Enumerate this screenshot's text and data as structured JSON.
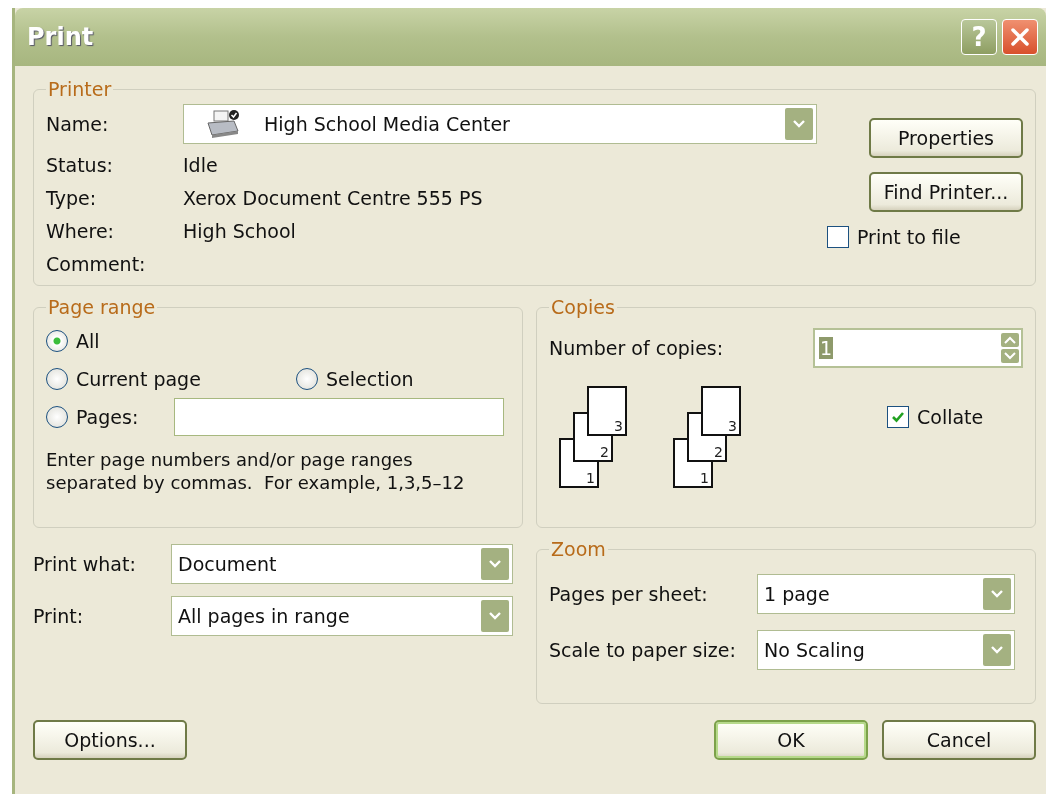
{
  "window": {
    "title": "Print",
    "help_label": "?"
  },
  "printer": {
    "title": "Printer",
    "name_label": "Name:",
    "name": "High School Media Center",
    "info": [
      {
        "label": "Status:",
        "value": "Idle"
      },
      {
        "label": "Type:",
        "value": "Xerox Document Centre 555 PS"
      },
      {
        "label": "Where:",
        "value": "High School"
      },
      {
        "label": "Comment:"
      }
    ],
    "properties_button": "Properties",
    "find_button": "Find Printer...",
    "print_to_file": {
      "label": "Print to file",
      "checked": false
    }
  },
  "page_range": {
    "title": "Page range",
    "options": [
      {
        "label": "All",
        "selected": true
      },
      {
        "label": "Current page",
        "selected": false
      },
      {
        "label": "Selection",
        "selected": false
      },
      {
        "label": "Pages:",
        "selected": false
      }
    ],
    "hint": "Enter page numbers and/or page ranges separated by commas.  For example, 1,3,5–12"
  },
  "copies": {
    "title": "Copies",
    "label": "Number of copies:",
    "value": "1",
    "stacks": [
      {
        "pages": [
          "1",
          "2",
          "3"
        ]
      },
      {
        "pages": [
          "1",
          "2",
          "3"
        ]
      }
    ],
    "collate": {
      "label": "Collate",
      "checked": true
    }
  },
  "print_what": {
    "label": "Print what:",
    "value": "Document"
  },
  "print": {
    "label": "Print:",
    "value": "All pages in range"
  },
  "zoom": {
    "title": "Zoom",
    "rows": [
      {
        "label": "Pages per sheet:",
        "value": "1 page"
      },
      {
        "label": "Scale to paper size:",
        "value": "No Scaling"
      }
    ]
  },
  "buttons": {
    "options": "Options...",
    "ok": "OK",
    "cancel": "Cancel"
  }
}
